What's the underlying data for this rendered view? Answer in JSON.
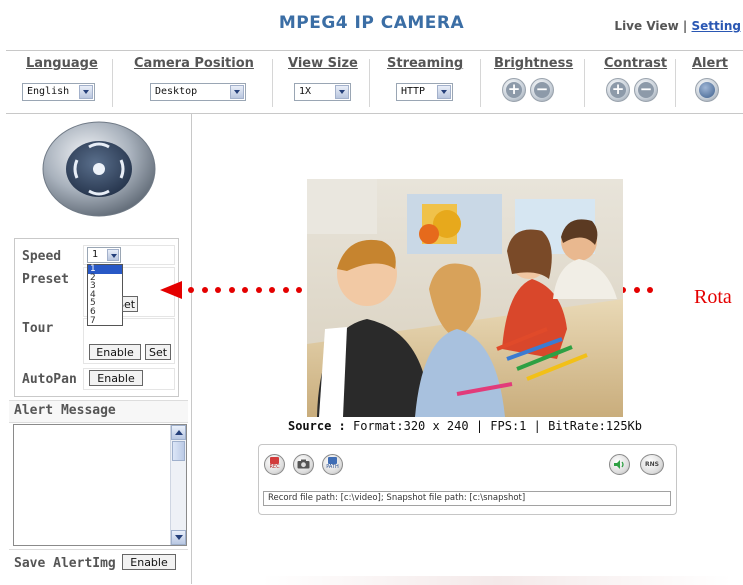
{
  "header": {
    "title": "MPEG4 IP CAMERA",
    "live_view": "Live View",
    "separator": "|",
    "setting": "Setting"
  },
  "toolbar": {
    "language": {
      "label": "Language",
      "value": "English"
    },
    "camera_position": {
      "label": "Camera Position",
      "value": "Desktop"
    },
    "view_size": {
      "label": "View Size",
      "value": "1X"
    },
    "streaming": {
      "label": "Streaming",
      "value": "HTTP"
    },
    "brightness": {
      "label": "Brightness"
    },
    "contrast": {
      "label": "Contrast"
    },
    "alert": {
      "label": "Alert"
    }
  },
  "ptz": {
    "speed_label": "Speed",
    "speed_value": "1",
    "speed_options": [
      "1",
      "2",
      "3",
      "4",
      "5",
      "6",
      "7"
    ],
    "preset_label": "Preset",
    "preset_set": "Set",
    "tour_label": "Tour",
    "tour_enable": "Enable",
    "tour_set": "Set",
    "autopan_label": "AutoPan",
    "autopan_enable": "Enable"
  },
  "alert": {
    "message_label": "Alert Message",
    "save_label": "Save AlertImg",
    "save_enable": "Enable"
  },
  "annotation": {
    "text": "Rota",
    "color": "#e40000"
  },
  "video": {
    "source_label": "Source :",
    "source_info": "Format:320 x 240 | FPS:1 | BitRate:125Kb"
  },
  "controls": {
    "rec": "REC",
    "path": "PATH",
    "rns": "RNS",
    "path_text": "Record file path: [c:\\video]; Snapshot file path: [c:\\snapshot]"
  },
  "icons": [
    "ptz-joystick-icon",
    "plus-icon",
    "minus-icon",
    "alert-icon",
    "rec-icon",
    "camera-icon",
    "path-icon",
    "speaker-icon",
    "rns-icon"
  ]
}
